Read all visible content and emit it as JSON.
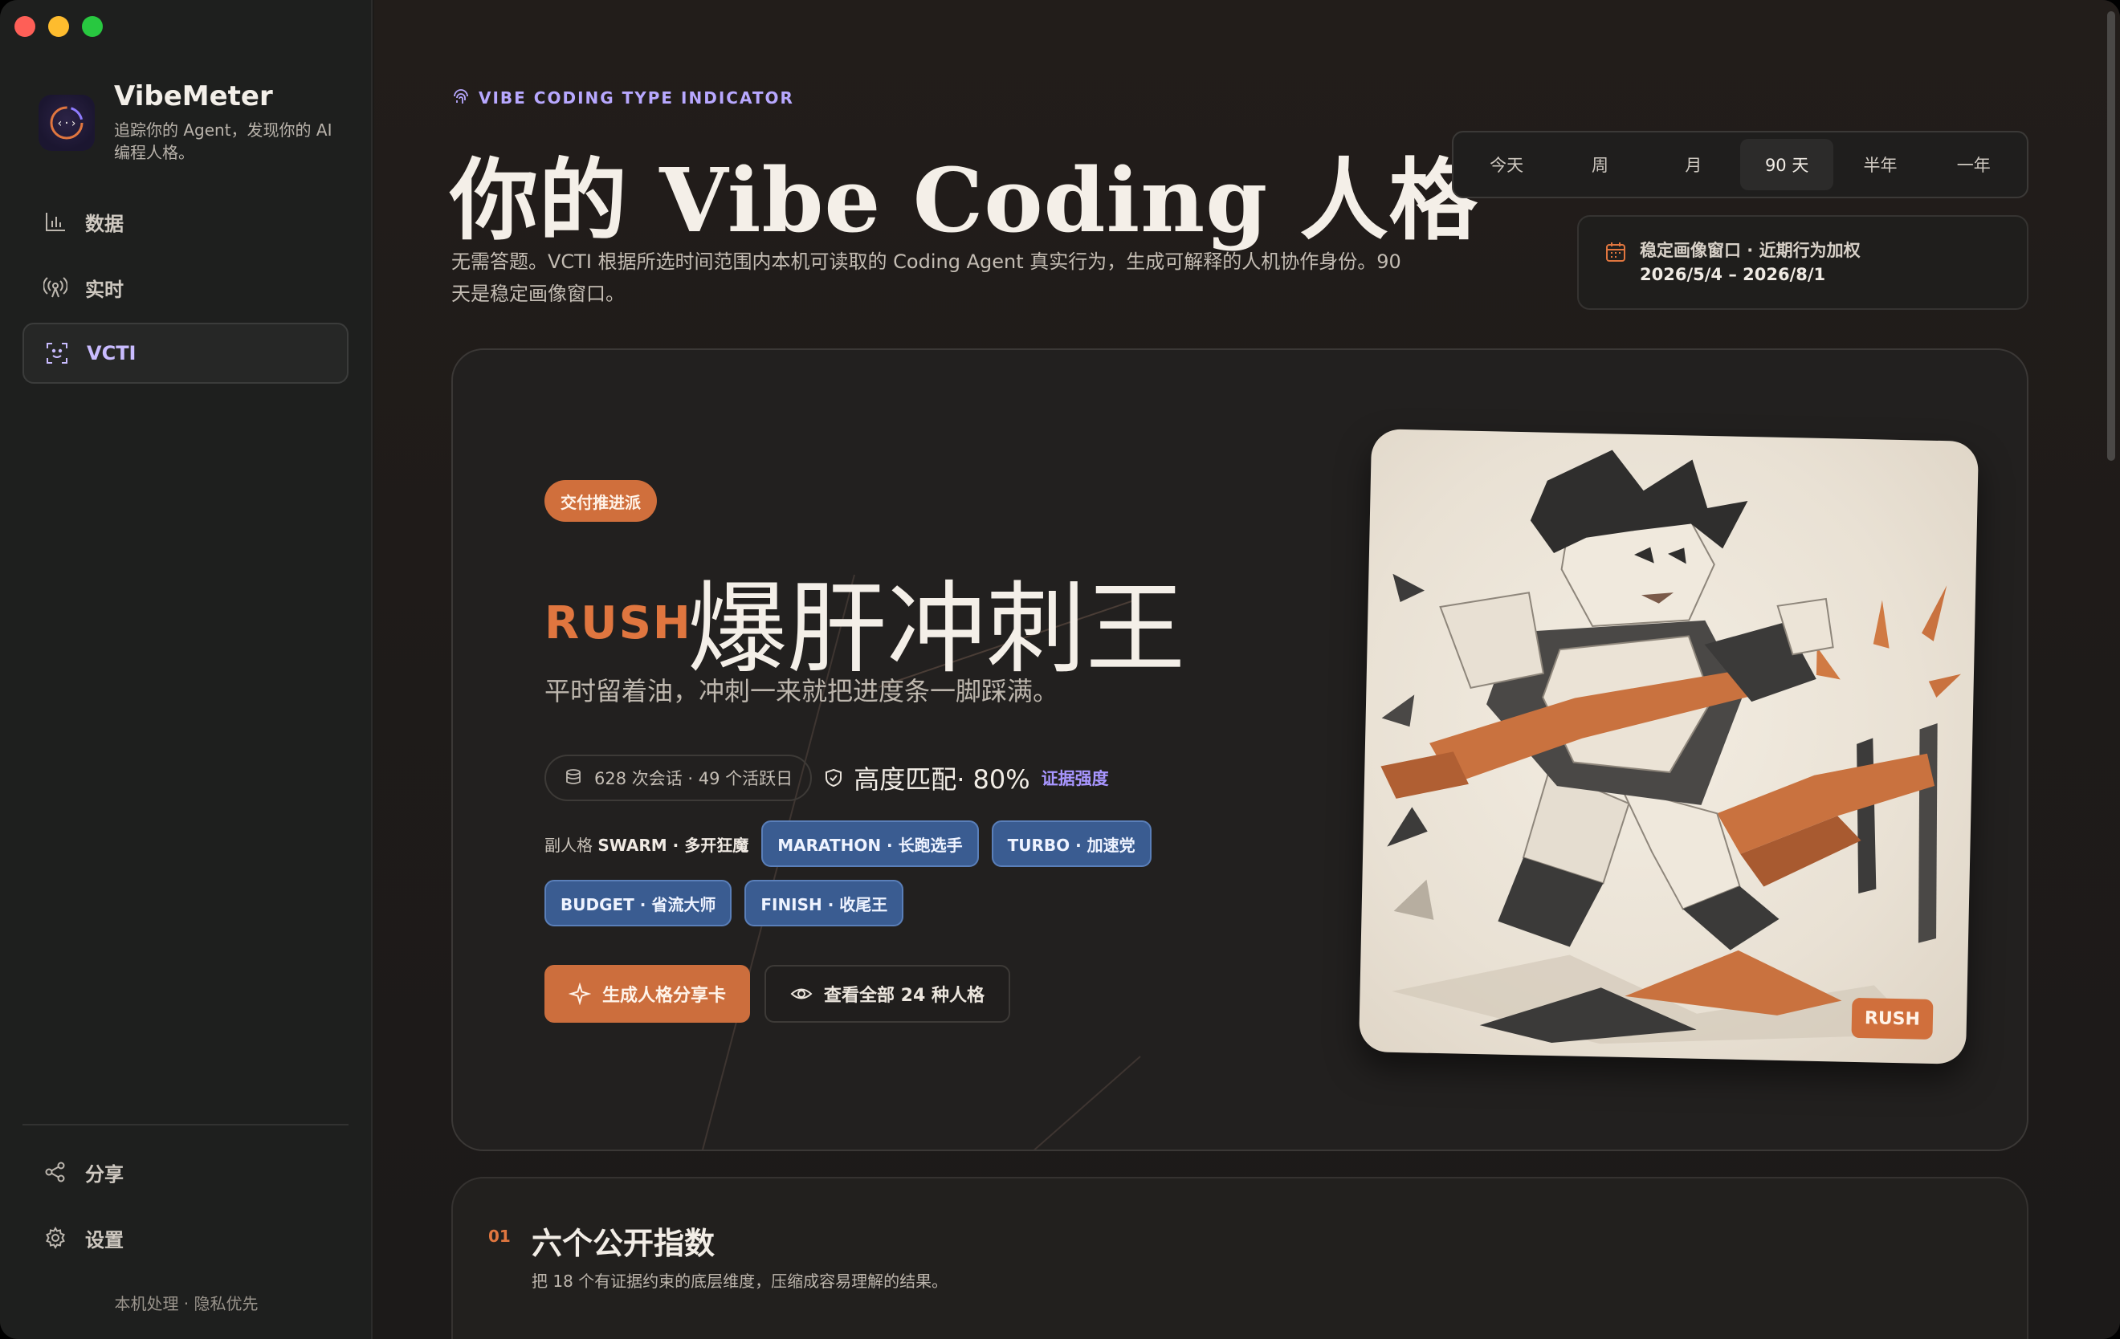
{
  "app": {
    "name": "VibeMeter",
    "tagline": "追踪你的 Agent，发现你的 AI 编程人格。"
  },
  "sidebar": {
    "items": [
      {
        "label": "数据",
        "icon": "bar-chart-icon"
      },
      {
        "label": "实时",
        "icon": "broadcast-icon"
      },
      {
        "label": "VCTI",
        "icon": "face-scan-icon",
        "active": true
      }
    ],
    "bottom": [
      {
        "label": "分享",
        "icon": "share-icon"
      },
      {
        "label": "设置",
        "icon": "gear-icon"
      }
    ],
    "footer": "本机处理 · 隐私优先"
  },
  "header": {
    "eyebrow": "VIBE CODING TYPE INDICATOR",
    "title": "你的 Vibe Coding 人格",
    "subtitle": "无需答题。VCTI 根据所选时间范围内本机可读取的 Coding Agent 真实行为，生成可解释的人机协作身份。90 天是稳定画像窗口。"
  },
  "range": {
    "options": [
      "今天",
      "周",
      "月",
      "90 天",
      "半年",
      "一年"
    ],
    "selected": "90 天"
  },
  "window_info": {
    "label": "稳定画像窗口 · 近期行为加权",
    "range": "2026/5/4 – 2026/8/1"
  },
  "hero": {
    "badge": "交付推进派",
    "code": "RUSH",
    "name": "爆肝冲刺王",
    "tagline": "平时留着油，冲刺一来就把进度条一脚踩满。",
    "sessions": "628 次会话 · 49 个活跃日",
    "match": "高度匹配· 80%",
    "evidence": "证据强度",
    "sub_label_prefix": "副人格",
    "sub_label_value": "SWARM · 多开狂魔",
    "chips": [
      "MARATHON · 长跑选手",
      "TURBO · 加速党",
      "BUDGET · 省流大师",
      "FINISH · 收尾王"
    ],
    "primary_btn": "生成人格分享卡",
    "secondary_btn": "查看全部 24 种人格",
    "art_badge": "RUSH"
  },
  "section": {
    "number": "01",
    "title": "六个公开指数",
    "subtitle": "把 18 个有证据约束的底层维度，压缩成容易理解的结果。"
  },
  "colors": {
    "accent_orange": "#d06f3c",
    "accent_purple": "#b8a8ff",
    "chip_blue": "#3a5c91"
  }
}
